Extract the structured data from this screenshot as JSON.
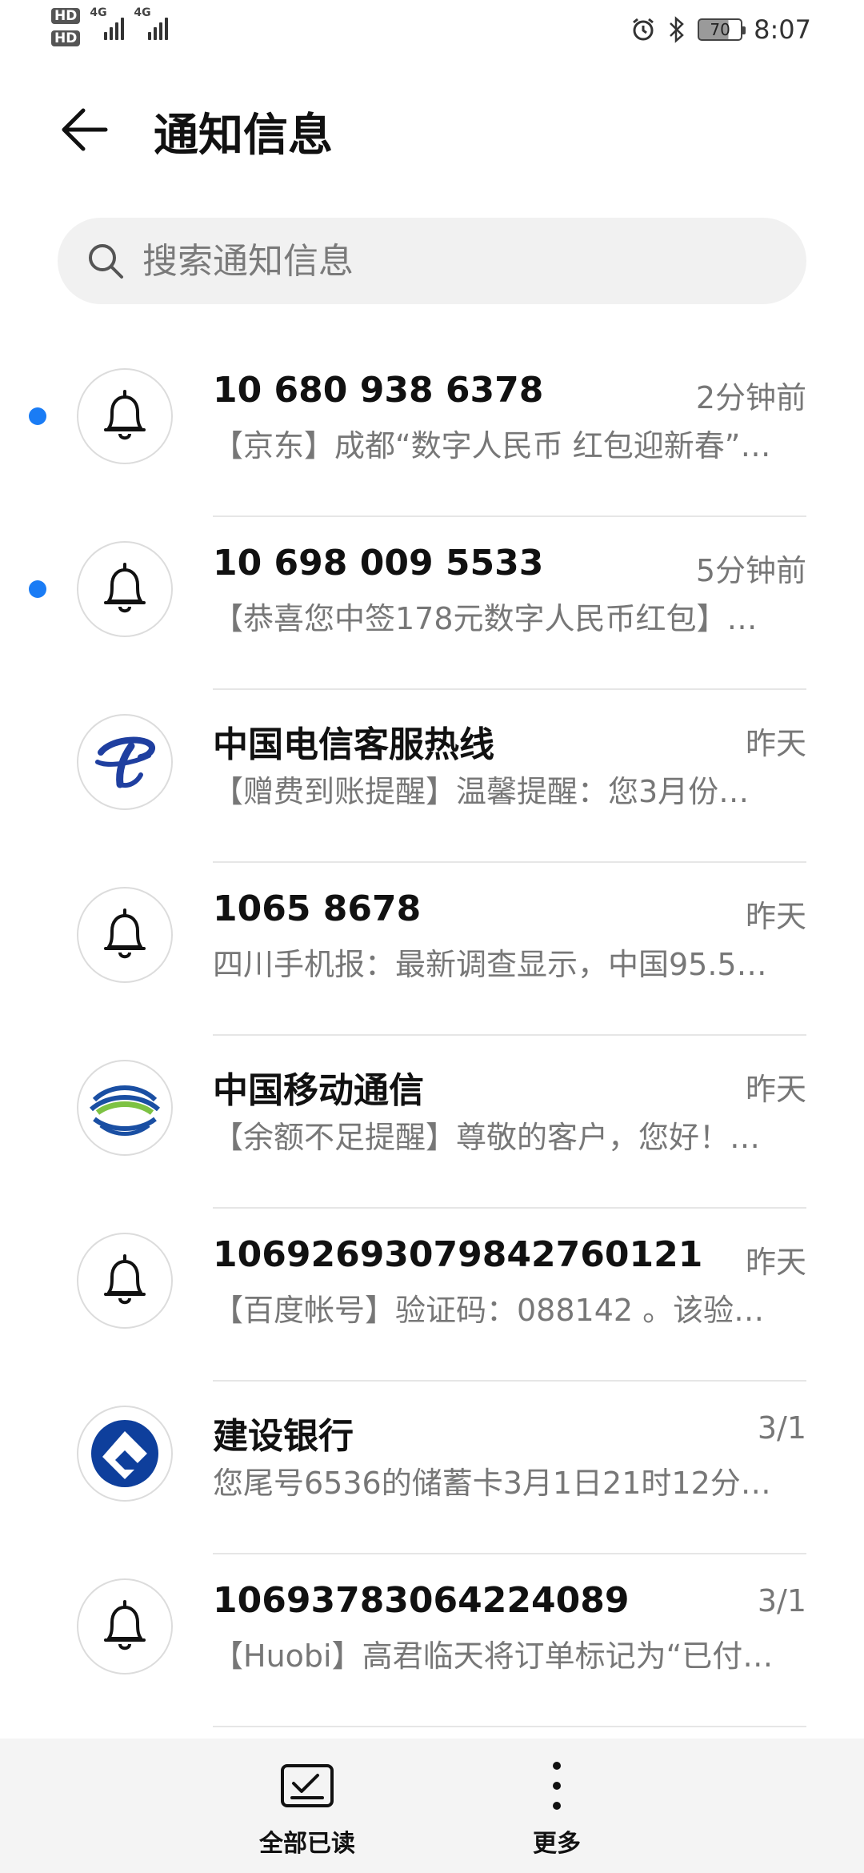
{
  "status_bar": {
    "left": [
      "HD1",
      "HD2",
      "4G",
      "4G"
    ],
    "battery": "70",
    "time": "8:07"
  },
  "header": {
    "title": "通知信息"
  },
  "search": {
    "placeholder": "搜索通知信息",
    "value": ""
  },
  "messages": [
    {
      "sender": "10 680 938 6378",
      "time": "2分钟前",
      "preview": "【京东】成都“数字人民币 红包迎新春”…",
      "unread": true,
      "avatar": "bell-icon"
    },
    {
      "sender": "10 698 009 5533",
      "time": "5分钟前",
      "preview": "【恭喜您中签178元数字人民币红包】…",
      "unread": true,
      "avatar": "bell-icon"
    },
    {
      "sender": "中国电信客服热线",
      "time": "昨天",
      "preview": "【赠费到账提醒】温馨提醒：您3月份…",
      "unread": false,
      "avatar": "china-telecom-logo"
    },
    {
      "sender": "1065 8678",
      "time": "昨天",
      "preview": "四川手机报：最新调查显示，中国95.5…",
      "unread": false,
      "avatar": "bell-icon"
    },
    {
      "sender": "中国移动通信",
      "time": "昨天",
      "preview": "【余额不足提醒】尊敬的客户，您好！…",
      "unread": false,
      "avatar": "china-mobile-logo"
    },
    {
      "sender": "10692693079842760121",
      "time": "昨天",
      "preview": "【百度帐号】验证码：088142 。该验…",
      "unread": false,
      "avatar": "bell-icon"
    },
    {
      "sender": "建设银行",
      "time": "3/1",
      "preview": "您尾号6536的储蓄卡3月1日21时12分…",
      "unread": false,
      "avatar": "ccb-logo"
    },
    {
      "sender": "10693783064224089",
      "time": "3/1",
      "preview": "【Huobi】高君临天将订单标记为“已付…",
      "unread": false,
      "avatar": "bell-icon"
    }
  ],
  "bottom_bar": {
    "mark_all_read": "全部已读",
    "more": "更多"
  },
  "colors": {
    "unread_dot": "#1a7cf5",
    "telecom_blue": "#1f3fa0",
    "mobile_blue": "#1a4fa3",
    "mobile_green": "#7dc243",
    "ccb_blue": "#0e3f9c"
  }
}
